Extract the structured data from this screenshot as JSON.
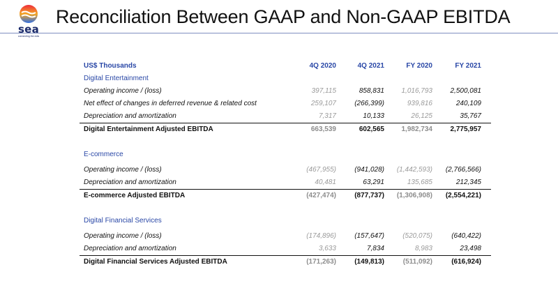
{
  "logo": {
    "word": "sea",
    "tagline": "connecting the dots"
  },
  "title": "Reconciliation Between GAAP and Non-GAAP EBITDA",
  "table": {
    "header_label": "US$ Thousands",
    "columns": [
      "4Q 2020",
      "4Q 2021",
      "FY 2020",
      "FY 2021"
    ],
    "sections": [
      {
        "name": "Digital Entertainment",
        "rows": [
          {
            "label": "Operating income / (loss)",
            "values": [
              "397,115",
              "858,831",
              "1,016,793",
              "2,500,081"
            ]
          },
          {
            "label": "Net effect of changes in deferred revenue & related cost",
            "values": [
              "259,107",
              "(266,399)",
              "939,816",
              "240,109"
            ]
          },
          {
            "label": "Depreciation and amortization",
            "values": [
              "7,317",
              "10,133",
              "26,125",
              "35,767"
            ]
          }
        ],
        "total": {
          "label": "Digital Entertainment Adjusted EBITDA",
          "values": [
            "663,539",
            "602,565",
            "1,982,734",
            "2,775,957"
          ]
        }
      },
      {
        "name": "E-commerce",
        "rows": [
          {
            "label": "Operating income / (loss)",
            "values": [
              "(467,955)",
              "(941,028)",
              "(1,442,593)",
              "(2,766,566)"
            ]
          },
          {
            "label": "Depreciation and amortization",
            "values": [
              "40,481",
              "63,291",
              "135,685",
              "212,345"
            ]
          }
        ],
        "total": {
          "label": "E-commerce Adjusted EBITDA",
          "values": [
            "(427,474)",
            "(877,737)",
            "(1,306,908)",
            "(2,554,221)"
          ]
        }
      },
      {
        "name": "Digital Financial Services",
        "rows": [
          {
            "label": "Operating income / (loss)",
            "values": [
              "(174,896)",
              "(157,647)",
              "(520,075)",
              "(640,422)"
            ]
          },
          {
            "label": "Depreciation and amortization",
            "values": [
              "3,633",
              "7,834",
              "8,983",
              "23,498"
            ]
          }
        ],
        "total": {
          "label": "Digital Financial Services Adjusted EBITDA",
          "values": [
            "(171,263)",
            "(149,813)",
            "(511,092)",
            "(616,924)"
          ]
        }
      }
    ]
  },
  "colors": {
    "accent_blue": "#2947a6",
    "logo_navy": "#1b2b6b",
    "logo_red": "#ee2c3c",
    "logo_orange": "#f5a623",
    "logo_blue": "#2f6fe4"
  }
}
